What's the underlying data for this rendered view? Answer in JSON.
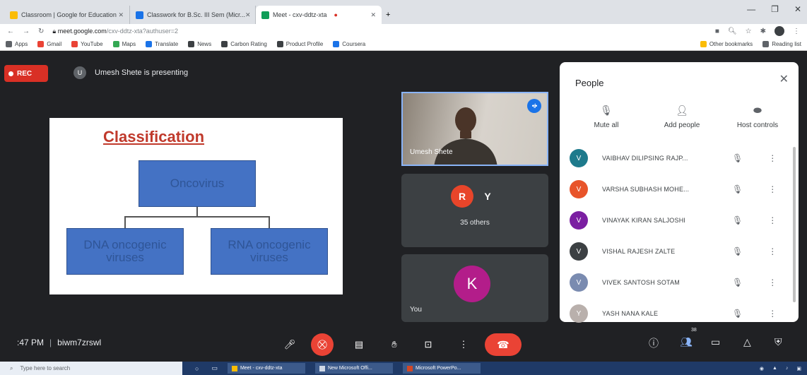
{
  "browser": {
    "tabs": [
      {
        "label": "Classroom | Google for Education",
        "color": "#fbbc04"
      },
      {
        "label": "Classwork for B.Sc. III Sem (Micr...",
        "color": "#1a73e8"
      },
      {
        "label": "Meet - cxv-ddtz-xta",
        "color": "#0f9d58"
      }
    ],
    "url_domain": "meet.google.com",
    "url_path": "/cxv-ddtz-xta?authuser=2",
    "bookmarks": [
      {
        "label": "Apps",
        "color": "#5f6368"
      },
      {
        "label": "Gmail",
        "color": "#ea4335"
      },
      {
        "label": "YouTube",
        "color": "#ea4335"
      },
      {
        "label": "Maps",
        "color": "#34a853"
      },
      {
        "label": "Translate",
        "color": "#1a73e8"
      },
      {
        "label": "News",
        "color": "#3c4043"
      },
      {
        "label": "Carbon Rating",
        "color": "#3c4043"
      },
      {
        "label": "Product Profile",
        "color": "#3c4043"
      },
      {
        "label": "Coursera",
        "color": "#1a73e8"
      }
    ],
    "bookmarks_right": [
      "Other bookmarks",
      "Reading list"
    ]
  },
  "meet": {
    "rec_label": "REC",
    "presenter_initial": "U",
    "presenting_text": "Umesh Shete is presenting",
    "slide": {
      "title": "Classification",
      "top_box": "Oncovirus",
      "left_box": "DNA oncogenic viruses",
      "right_box": "RNA oncogenic viruses"
    },
    "cam_name": "Umesh Shete",
    "others_initials": [
      "R",
      "Y"
    ],
    "others_label": "35 others",
    "you_initial": "K",
    "you_label": "You",
    "time": ":47 PM",
    "meeting_code": "biwm7zrswl",
    "participant_count": "38"
  },
  "people": {
    "title": "People",
    "actions": [
      {
        "label": "Mute all",
        "icon": "mic-off-icon"
      },
      {
        "label": "Add people",
        "icon": "person-add-icon"
      },
      {
        "label": "Host controls",
        "icon": "toggle-icon"
      }
    ],
    "participants": [
      {
        "initial": "V",
        "name": "VAIBHAV DILIPSING RAJP...",
        "color": "#1e7a8c"
      },
      {
        "initial": "V",
        "name": "VARSHA SUBHASH MOHE...",
        "color": "#e8542a"
      },
      {
        "initial": "V",
        "name": "VINAYAK KIRAN SALJOSHI",
        "color": "#7b1fa2"
      },
      {
        "initial": "V",
        "name": "VISHAL RAJESH ZALTE",
        "color": "#3c4043"
      },
      {
        "initial": "V",
        "name": "VIVEK SANTOSH SOTAM",
        "color": "#7a8bb0"
      },
      {
        "initial": "Y",
        "name": "YASH NANA KALE",
        "color": "#b9b0ac"
      }
    ]
  },
  "taskbar": {
    "search_placeholder": "Type here to search",
    "apps": [
      "Meet - cxv-ddtz-xta",
      "New Microsoft Offi...",
      "Microsoft PowerPo..."
    ]
  }
}
